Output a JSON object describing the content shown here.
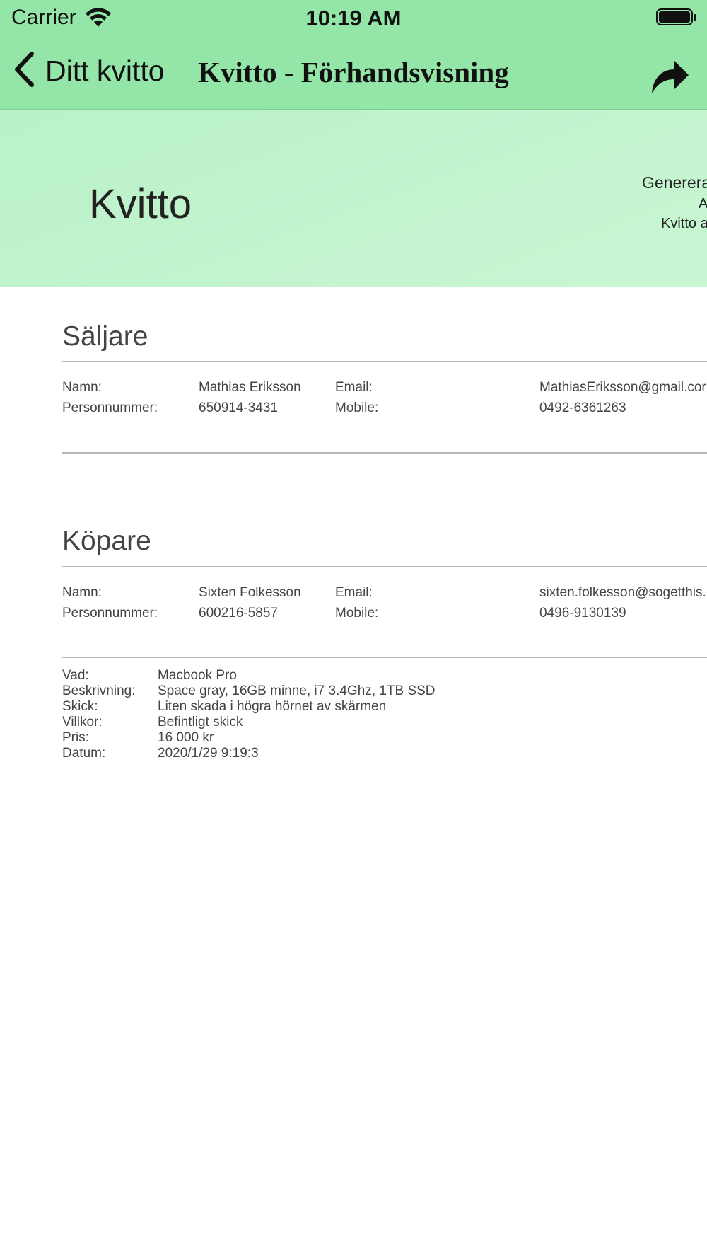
{
  "status_bar": {
    "carrier": "Carrier",
    "time": "10:19 AM"
  },
  "nav": {
    "back_label": "Ditt kvitto",
    "title": "Kvitto - Förhandsvisning"
  },
  "receipt": {
    "title": "Kvitto",
    "generated_partial": "Generera",
    "line2_partial": "A",
    "line3_partial": "Kvitto a"
  },
  "seller": {
    "heading": "Säljare",
    "name_label": "Namn:",
    "name": "Mathias Eriksson",
    "email_label": "Email:",
    "email": "MathiasEriksson@gmail.cor",
    "pnr_label": "Personnummer:",
    "pnr": "650914-3431",
    "mobile_label": "Mobile:",
    "mobile": "0492-6361263"
  },
  "buyer": {
    "heading": "Köpare",
    "name_label": "Namn:",
    "name": "Sixten Folkesson",
    "email_label": "Email:",
    "email": "sixten.folkesson@sogetthis.",
    "pnr_label": "Personnummer:",
    "pnr": "600216-5857",
    "mobile_label": "Mobile:",
    "mobile": "0496-9130139"
  },
  "details": [
    {
      "label": "Vad:",
      "value": "Macbook Pro"
    },
    {
      "label": "Beskrivning:",
      "value": "Space gray, 16GB minne, i7 3.4Ghz, 1TB SSD"
    },
    {
      "label": "Skick:",
      "value": "Liten skada i högra hörnet av skärmen"
    },
    {
      "label": "Villkor:",
      "value": "Befintligt skick"
    },
    {
      "label": "Pris:",
      "value": "16 000 kr"
    },
    {
      "label": "Datum:",
      "value": "2020/1/29 9:19:3"
    }
  ],
  "icons": {
    "wifi": "wifi-icon",
    "battery": "battery-icon",
    "back": "chevron-left-icon",
    "share": "share-icon"
  }
}
